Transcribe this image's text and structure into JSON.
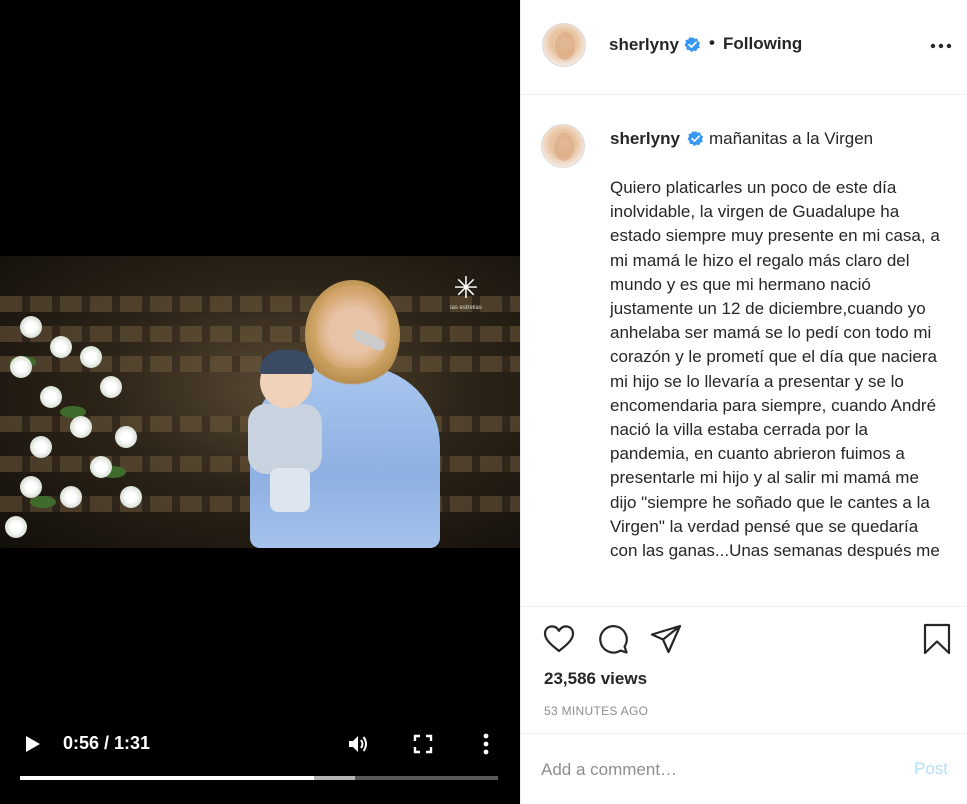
{
  "video": {
    "time": "0:56 / 1:31",
    "progress": 0.615,
    "channel_logo_text": "las estrellas"
  },
  "header": {
    "username": "sherlyny",
    "separator": "•",
    "following_label": "Following"
  },
  "caption": {
    "username": "sherlyny",
    "title": "mañanitas a la Virgen",
    "body": "Quiero platicarles un poco de este día inolvidable, la virgen de Guadalupe ha estado siempre muy presente en mi casa, a mi mamá le hizo el regalo más claro del mundo y es que mi hermano nació justamente un 12 de diciembre,cuando yo anhelaba ser mamá se lo pedí con todo mi corazón y le prometí que el día que naciera mi hijo se lo llevaría a presentar y se lo encomendaria para siempre, cuando André nació la villa estaba cerrada por la pandemia, en cuanto abrieron fuimos a presentarle mi hijo y al salir mi mamá me dijo \"siempre he soñado que le cantes a la Virgen\" la verdad pensé que se quedaría con las ganas...Unas semanas después me"
  },
  "stats": {
    "views": "23,586 views",
    "timestamp": "53 MINUTES AGO"
  },
  "comment": {
    "placeholder": "Add a comment…",
    "post_label": "Post"
  },
  "colors": {
    "verified": "#3897f0",
    "post_button": "#b2dffc",
    "text": "#262626",
    "muted": "#8e8e8e"
  }
}
